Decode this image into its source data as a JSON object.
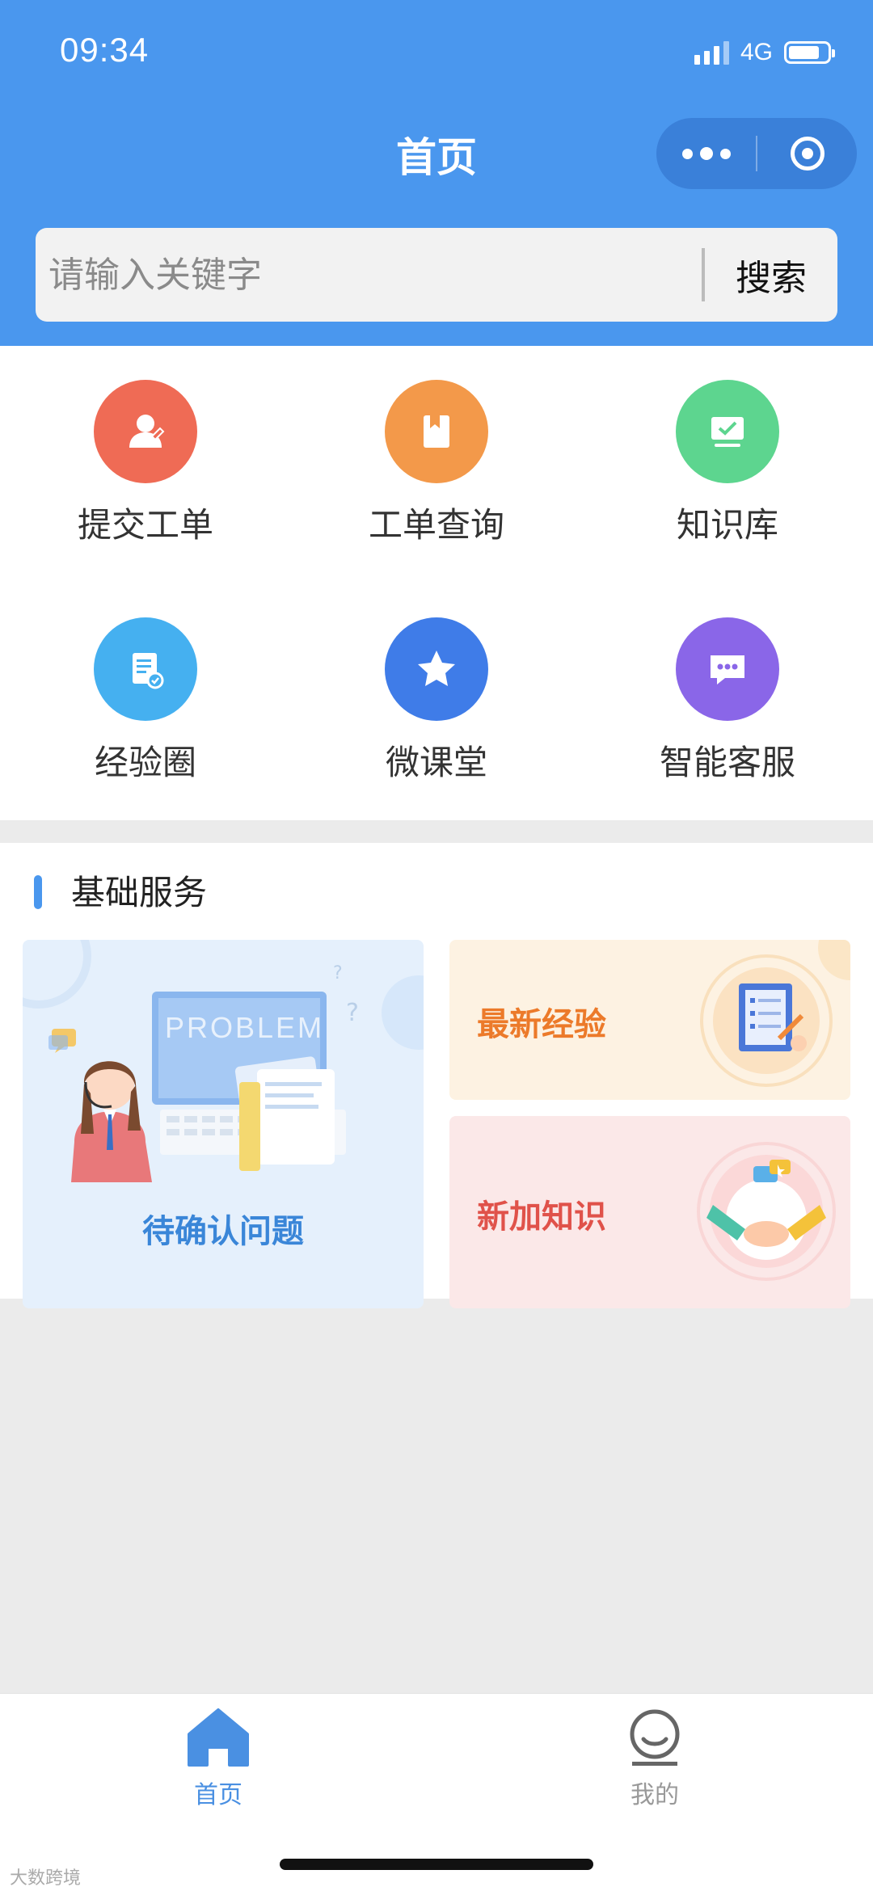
{
  "status_bar": {
    "time": "09:34",
    "network": "4G",
    "battery_level": 0.8
  },
  "nav": {
    "title": "首页"
  },
  "search": {
    "placeholder": "请输入关键字",
    "button": "搜索"
  },
  "grid": [
    {
      "label": "提交工单",
      "icon": "user-icon",
      "color": "#ef6b55"
    },
    {
      "label": "工单查询",
      "icon": "book-icon",
      "color": "#f3994a"
    },
    {
      "label": "知识库",
      "icon": "monitor-check-icon",
      "color": "#5dd58f"
    },
    {
      "label": "经验圈",
      "icon": "document-check-icon",
      "color": "#45b0f0"
    },
    {
      "label": "微课堂",
      "icon": "star-icon",
      "color": "#3f7ce8"
    },
    {
      "label": "智能客服",
      "icon": "chat-bubble-icon",
      "color": "#8a66e8"
    }
  ],
  "section": {
    "title": "基础服务",
    "cards": {
      "pending": {
        "label": "待确认问题",
        "screen_text": "PROBLEM",
        "color": "#3a86d8"
      },
      "experience": {
        "label": "最新经验",
        "color": "#ec7a2a"
      },
      "knowledge": {
        "label": "新加知识",
        "color": "#e0524a"
      }
    }
  },
  "tabbar": {
    "items": [
      {
        "label": "首页",
        "icon": "home-icon",
        "active": true
      },
      {
        "label": "我的",
        "icon": "profile-icon",
        "active": false
      }
    ],
    "active_color": "#4a90e2",
    "inactive_color": "#999999"
  },
  "watermark": "大数跨境"
}
